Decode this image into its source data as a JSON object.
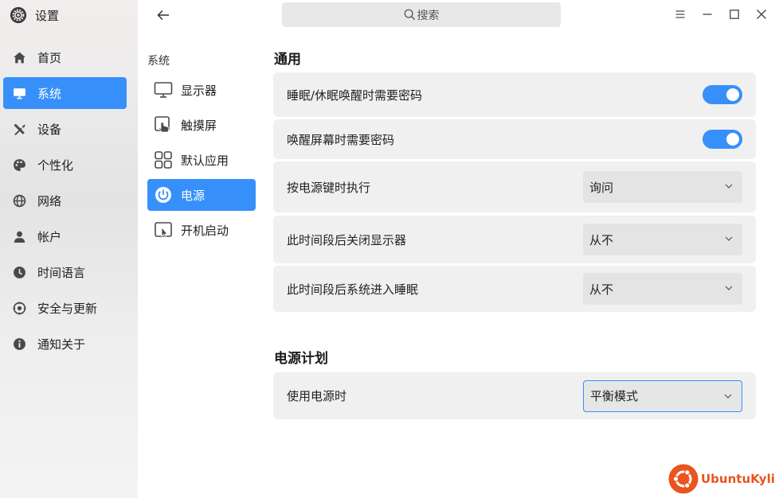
{
  "app": {
    "title": "设置"
  },
  "sidebar": {
    "items": [
      {
        "label": "首页",
        "icon": "home-icon"
      },
      {
        "label": "系统",
        "icon": "monitor-icon",
        "active": true
      },
      {
        "label": "设备",
        "icon": "tools-icon"
      },
      {
        "label": "个性化",
        "icon": "palette-icon"
      },
      {
        "label": "网络",
        "icon": "globe-icon"
      },
      {
        "label": "帐户",
        "icon": "user-icon"
      },
      {
        "label": "时间语言",
        "icon": "clock-icon"
      },
      {
        "label": "安全与更新",
        "icon": "shield-icon"
      },
      {
        "label": "通知关于",
        "icon": "info-icon"
      }
    ]
  },
  "subnav": {
    "title": "系统",
    "items": [
      {
        "label": "显示器",
        "icon": "display-icon"
      },
      {
        "label": "触摸屏",
        "icon": "touchscreen-icon"
      },
      {
        "label": "默认应用",
        "icon": "apps-grid-icon"
      },
      {
        "label": "电源",
        "icon": "power-icon",
        "active": true
      },
      {
        "label": "开机启动",
        "icon": "autostart-icon"
      }
    ]
  },
  "search": {
    "placeholder": "搜索"
  },
  "general": {
    "title": "通用",
    "sleep_password": {
      "label": "睡眠/休眠唤醒时需要密码",
      "enabled": true
    },
    "screen_password": {
      "label": "唤醒屏幕时需要密码",
      "enabled": true
    },
    "power_key": {
      "label": "按电源键时执行",
      "value": "询问"
    },
    "display_off": {
      "label": "此时间段后关闭显示器",
      "value": "从不"
    },
    "sleep_after": {
      "label": "此时间段后系统进入睡眠",
      "value": "从不"
    }
  },
  "power_plan": {
    "title": "电源计划",
    "on_power": {
      "label": "使用电源时",
      "value": "平衡模式"
    }
  },
  "brand": {
    "name": "UbuntuKylin"
  },
  "colors": {
    "accent": "#3790fa",
    "brand": "#e95420"
  }
}
